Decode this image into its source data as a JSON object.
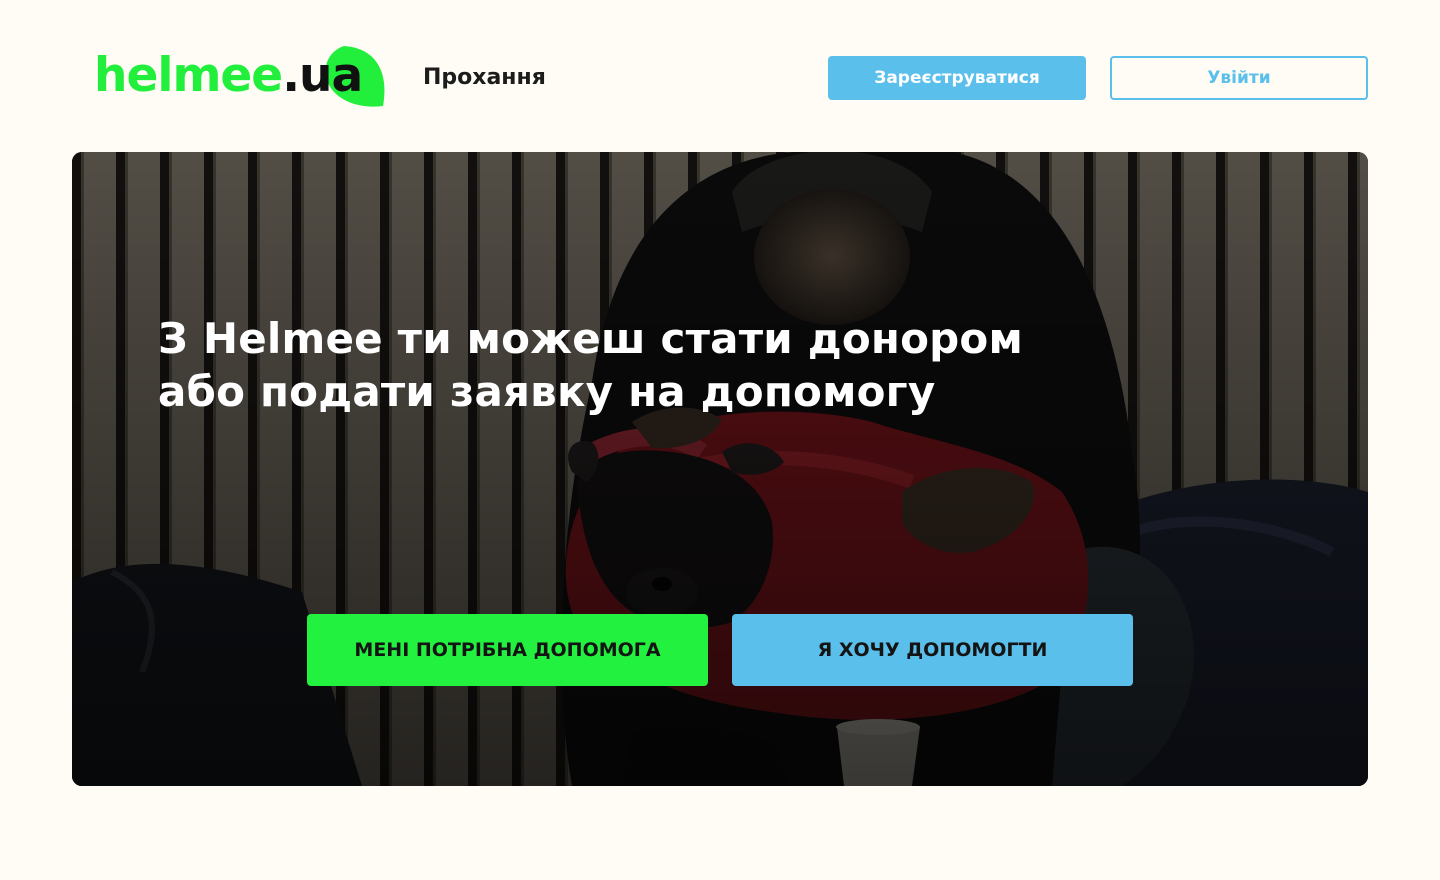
{
  "header": {
    "logo": {
      "text_main": "helmee",
      "text_domain": ".ua",
      "brand_color": "#22ee3c",
      "leaf_color": "#22ee3c",
      "domain_color": "#111111"
    },
    "nav_requests_label": "Прохання",
    "register_label": "Зареєструватися",
    "login_label": "Увійти"
  },
  "hero": {
    "image_icon": "hero-photo",
    "title_line1": "З Helmee ти можеш стати донором",
    "title_line2": "або подати заявку на допомогу",
    "need_help_label": "МЕНІ ПОТРІБНА ДОПОМОГА",
    "want_help_label": "Я ХОЧУ ДОПОМОГТИ"
  },
  "colors": {
    "background": "#fefcf4",
    "accent_blue": "#5bbfec",
    "accent_green": "#22f23f",
    "text_dark": "#1c1c1c"
  }
}
